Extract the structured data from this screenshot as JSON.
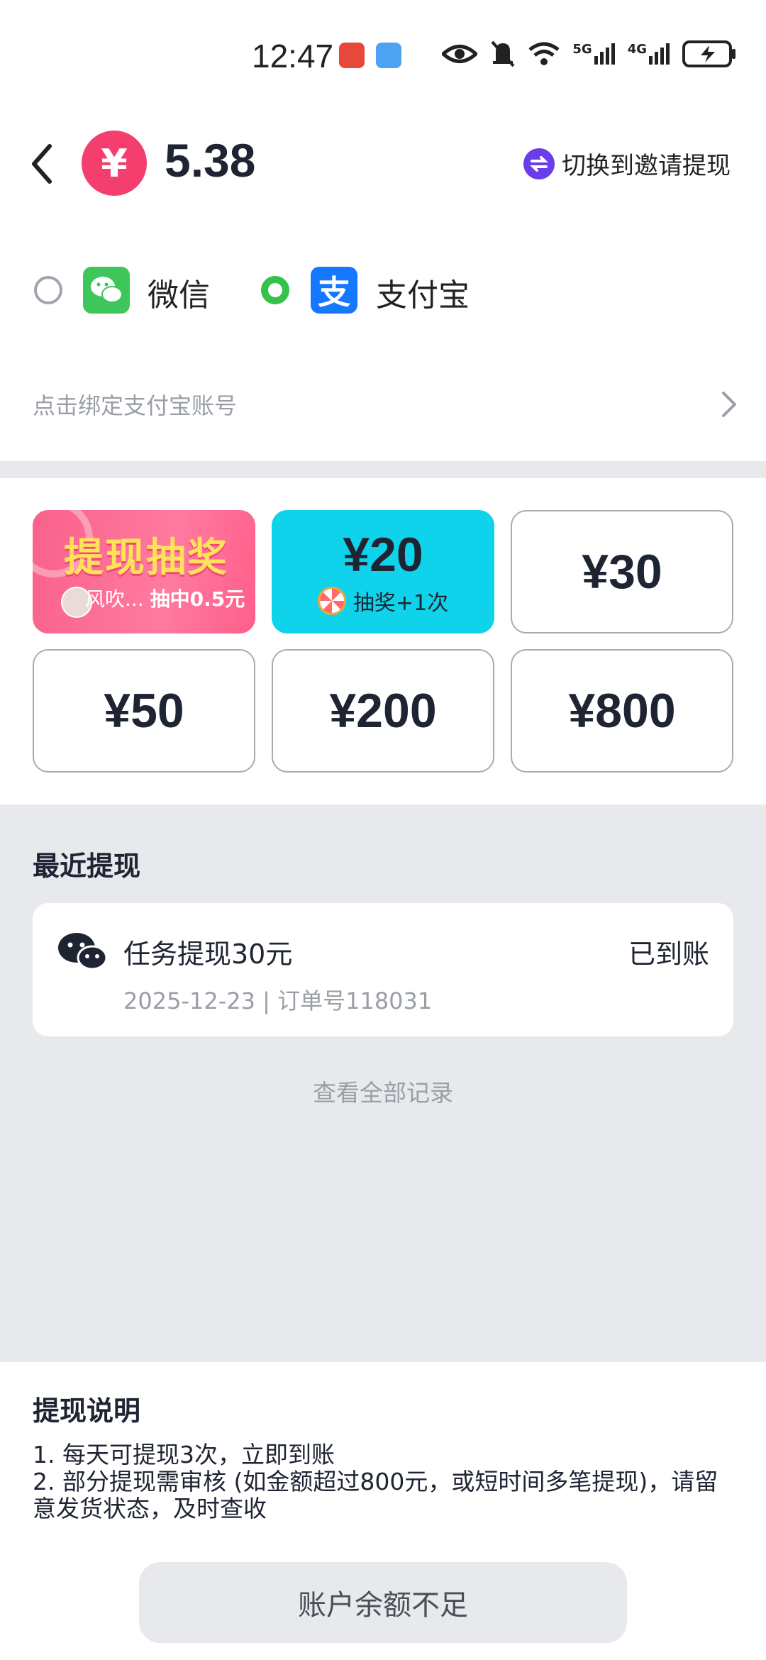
{
  "status_bar": {
    "time": "12:47",
    "app_icons": [
      "huawei-app-icon",
      "weather-icon"
    ],
    "indicators": [
      "eye-icon",
      "mute-icon",
      "wifi-icon",
      "5g-signal-icon",
      "4g-signal-icon",
      "battery-charging-icon"
    ],
    "network_5g": "5G",
    "network_4g": "4G"
  },
  "header": {
    "back_icon": "chevron-left-icon",
    "currency_symbol": "¥",
    "balance": "5.38",
    "switch_label": "切换到邀请提现"
  },
  "payment_methods": [
    {
      "label": "微信",
      "selected": false,
      "icon": "wechat-icon"
    },
    {
      "label": "支付宝",
      "selected": true,
      "icon": "alipay-icon"
    }
  ],
  "alipay_logo_char": "支",
  "bind_account": {
    "label": "点击绑定支付宝账号"
  },
  "amount_options": {
    "lottery": {
      "title": "提现抽奖",
      "user": "风吹...",
      "prize": "抽中0.5元"
    },
    "selected": {
      "amount": "¥20",
      "bonus": "抽奖+1次"
    },
    "others": [
      "¥30",
      "¥50",
      "¥200",
      "¥800"
    ]
  },
  "recent": {
    "title": "最近提现",
    "items": [
      {
        "title": "任务提现30元",
        "status": "已到账",
        "meta": "2025-12-23 | 订单号118031"
      }
    ],
    "view_all": "查看全部记录"
  },
  "instructions": {
    "title": "提现说明",
    "line1": "1. 每天可提现3次，立即到账",
    "line2": "2. 部分提现需审核 (如金额超过800元，或短时间多笔提现)，请留意发货状态，及时查收"
  },
  "bottom_button": "账户余额不足",
  "colors": {
    "accent_pink": "#f43f6e",
    "selected_cyan": "#0ed3eb",
    "wechat_green": "#3fc65a",
    "alipay_blue": "#1677ff",
    "radio_green": "#36c24a"
  }
}
